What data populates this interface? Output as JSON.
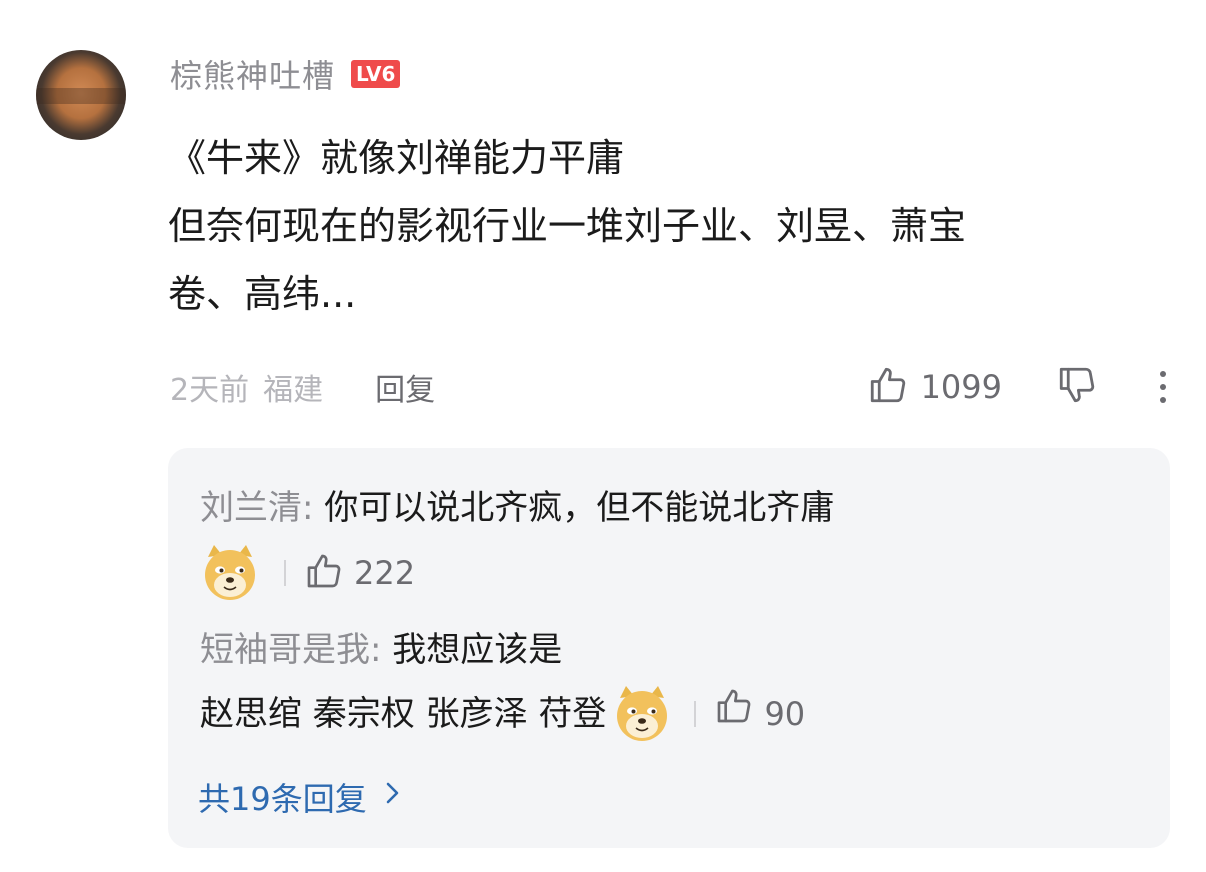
{
  "comment": {
    "username": "棕熊神吐槽",
    "level": "LV6",
    "content_lines": [
      "《牛来》就像刘禅能力平庸",
      "但奈何现在的影视行业一堆刘子业、刘昱、萧宝",
      "卷、高纬..."
    ],
    "time": "2天前",
    "location": "福建",
    "reply_label": "回复",
    "like_count": "1099"
  },
  "replies": [
    {
      "name": "刘兰清",
      "separator": ": ",
      "text": "你可以说北齐疯，但不能说北齐庸",
      "like_count": "222"
    },
    {
      "name": "短袖哥是我",
      "separator": ": ",
      "text_line1": "我想应该是",
      "text_line2": "赵思绾 秦宗权 张彦泽 苻登",
      "like_count": "90"
    }
  ],
  "total_replies_label": "共19条回复",
  "icons": {
    "like": "thumbs-up-icon",
    "dislike": "thumbs-down-icon",
    "more": "more-vertical-icon",
    "emoji": "doge-emoji-icon",
    "chevron": "chevron-right-icon"
  },
  "colors": {
    "level_badge": "#ef4b4b",
    "link": "#2e6ab0",
    "reply_bg": "#f4f5f7"
  }
}
